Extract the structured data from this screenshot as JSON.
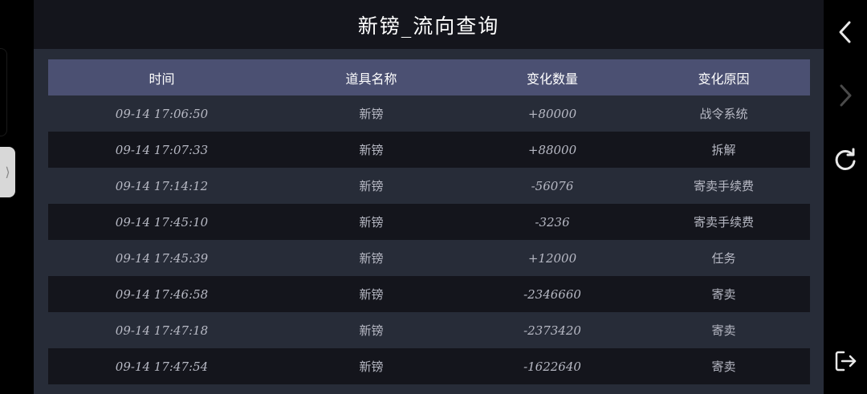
{
  "header": {
    "title": "新镑_流向查询"
  },
  "table": {
    "columns": [
      "时间",
      "道具名称",
      "变化数量",
      "变化原因"
    ],
    "rows": [
      {
        "time": "09-14 17:06:50",
        "item": "新镑",
        "change": "+80000",
        "reason": "战令系统"
      },
      {
        "time": "09-14 17:07:33",
        "item": "新镑",
        "change": "+88000",
        "reason": "拆解"
      },
      {
        "time": "09-14 17:14:12",
        "item": "新镑",
        "change": "-56076",
        "reason": "寄卖手续费"
      },
      {
        "time": "09-14 17:45:10",
        "item": "新镑",
        "change": "-3236",
        "reason": "寄卖手续费"
      },
      {
        "time": "09-14 17:45:39",
        "item": "新镑",
        "change": "+12000",
        "reason": "任务"
      },
      {
        "time": "09-14 17:46:58",
        "item": "新镑",
        "change": "-2346660",
        "reason": "寄卖"
      },
      {
        "time": "09-14 17:47:18",
        "item": "新镑",
        "change": "-2373420",
        "reason": "寄卖"
      },
      {
        "time": "09-14 17:47:54",
        "item": "新镑",
        "change": "-1622640",
        "reason": "寄卖"
      }
    ]
  },
  "side_handle": {
    "glyph": "⟩"
  },
  "nav": {
    "back_icon": "chevron-left-icon",
    "forward_icon": "chevron-right-icon",
    "reload_icon": "reload-icon",
    "exit_icon": "exit-icon"
  },
  "colors": {
    "header_bg": "#14151c",
    "panel_bg": "#272c38",
    "table_header_bg": "#4b5072",
    "row_dark": "#14151c",
    "text_light": "#b7b9c4"
  }
}
